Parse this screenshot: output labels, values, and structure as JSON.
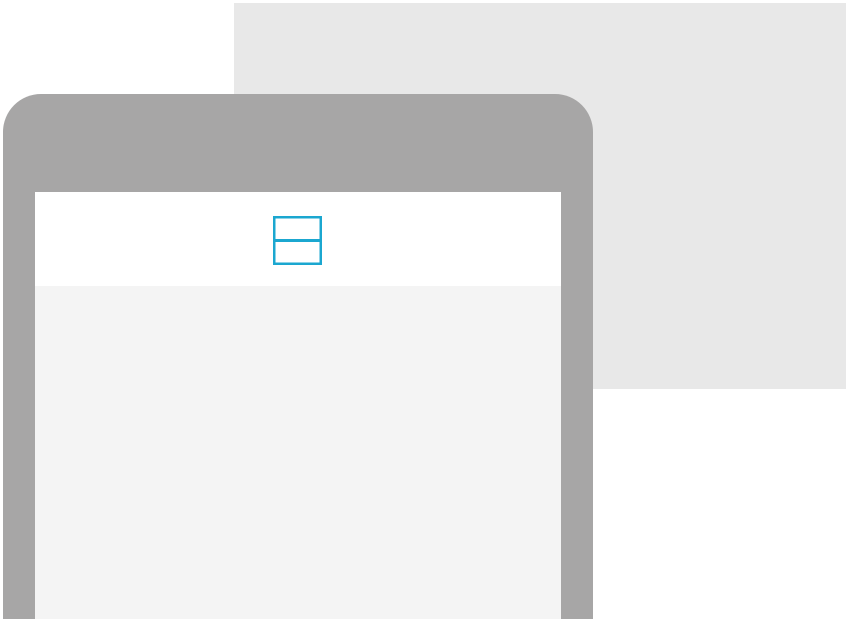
{
  "icons": {
    "layout": "split-layout-icon",
    "menu": "vertical-dots-icon"
  },
  "menu_dots": [
    1,
    2,
    3,
    4,
    5
  ],
  "colors": {
    "background": "#ffffff",
    "back_panel": "#e8e8e8",
    "device_frame": "#a7a6a6",
    "screen_body": "#f4f4f4",
    "screen_header": "#ffffff",
    "accent": "#1ba7d0"
  }
}
